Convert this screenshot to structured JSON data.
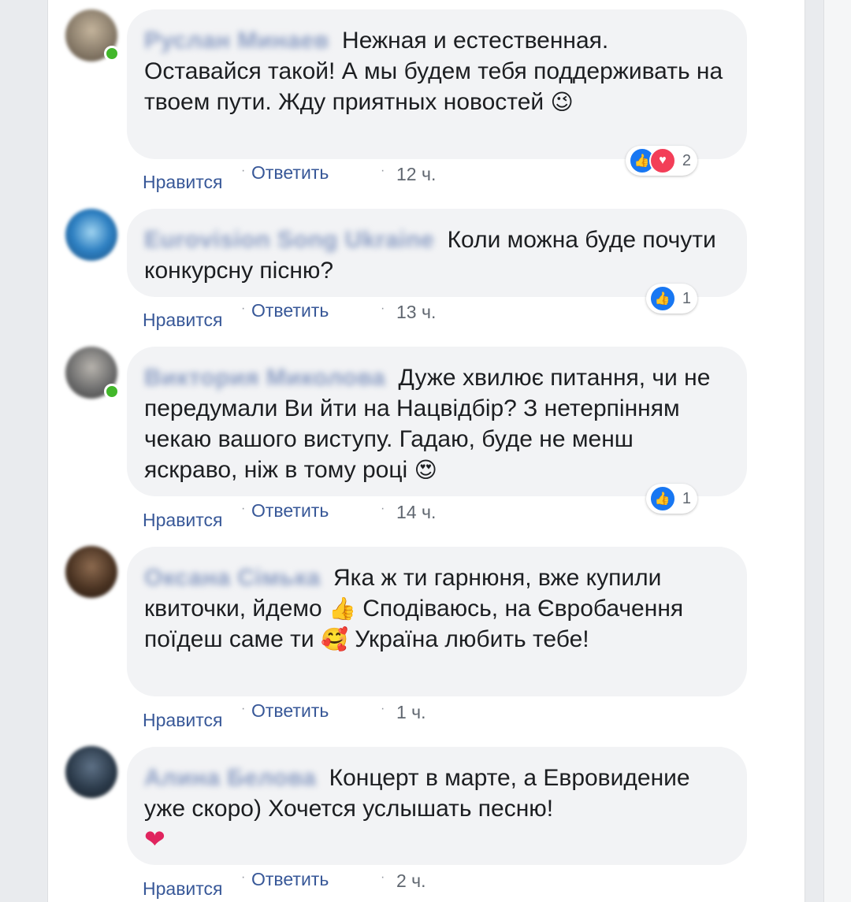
{
  "actions": {
    "like": "Нравится",
    "reply": "Ответить"
  },
  "comments": [
    {
      "author": "Руслан Минаев",
      "text": "Нежная и естественная. Оставайся такой! А мы будем тебя поддерживать на твоем пути. Жду приятных новостей",
      "emoji": "😉",
      "time": "12 ч.",
      "reactions": [
        "like-icon",
        "love-icon"
      ],
      "reaction_count": "2",
      "avatar_color": "#8a7d6b",
      "online": true
    },
    {
      "author": "Eurovision Song Ukraine",
      "text": "Коли можна буде почути конкурсну пісню?",
      "time": "13 ч.",
      "reactions": [
        "like-icon"
      ],
      "reaction_count": "1",
      "avatar_color": "#2d7fc1",
      "online": false
    },
    {
      "author": "Виктория Миколова",
      "text": "Дуже хвилює питання, чи не передумали Ви йти на Нацвідбір? З нетерпінням чекаю вашого виступу. Гадаю, буде не менш яскраво, ніж в тому році",
      "emoji": "😍",
      "time": "14 ч.",
      "reactions": [
        "like-icon"
      ],
      "reaction_count": "1",
      "avatar_color": "#6e6e6e",
      "online": true
    },
    {
      "author": "Оксана Сімька",
      "text_parts": [
        "Яка ж ти гарнюня, вже купили квиточки, йдемо",
        "👍",
        "Сподіваюсь, на Євробачення поїдеш саме ти",
        "🥰",
        "Україна любить тебе!"
      ],
      "time": "1 ч.",
      "avatar_color": "#4a3322",
      "online": false
    },
    {
      "author": "Алина Белова",
      "text": "Концерт в марте, а Евровидение уже скоро) Хочется услышать песню!",
      "emoji": "❤",
      "time": "2 ч.",
      "avatar_color": "#2b3a4a",
      "online": false
    }
  ]
}
